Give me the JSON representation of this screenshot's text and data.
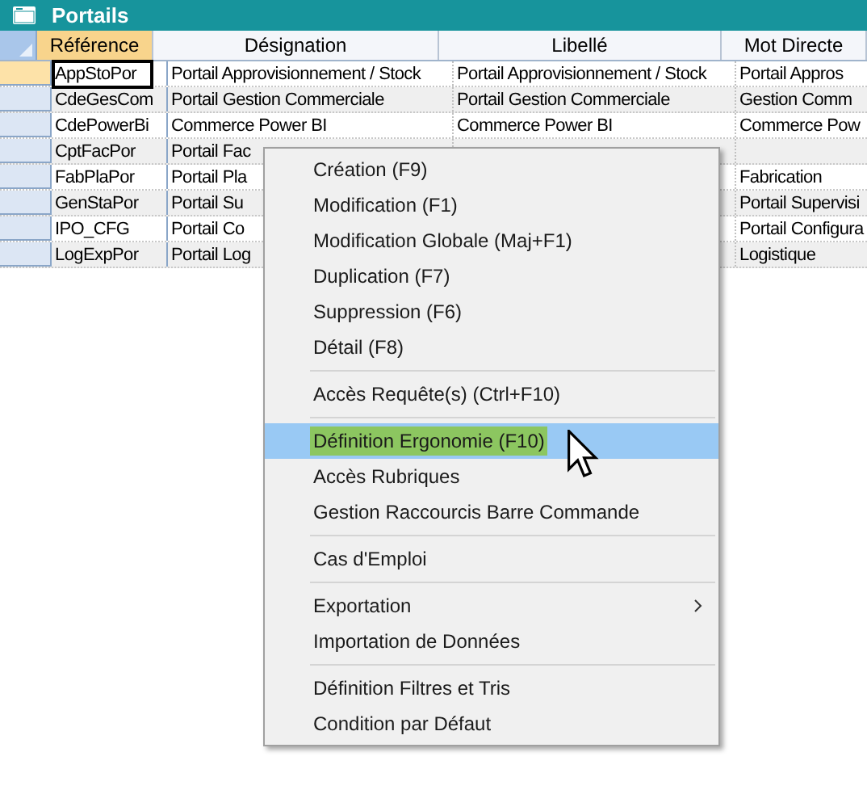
{
  "window": {
    "title": "Portails"
  },
  "table": {
    "columns": [
      {
        "label": "Référence",
        "sorted": true
      },
      {
        "label": "Désignation",
        "sorted": false
      },
      {
        "label": "Libellé",
        "sorted": false
      },
      {
        "label": "Mot Directe",
        "sorted": false
      }
    ],
    "rows": [
      {
        "selected": true,
        "cells": [
          "AppStoPor",
          "Portail Approvisionnement / Stock",
          "Portail Approvisionnement / Stock",
          "Portail Appros"
        ]
      },
      {
        "selected": false,
        "cells": [
          "CdeGesCom",
          "Portail Gestion Commerciale",
          "Portail Gestion Commerciale",
          "Gestion Comm"
        ]
      },
      {
        "selected": false,
        "cells": [
          "CdePowerBi",
          "Commerce Power BI",
          "Commerce Power BI",
          "Commerce Pow"
        ]
      },
      {
        "selected": false,
        "cells": [
          "CptFacPor",
          "Portail Fac",
          null,
          null
        ]
      },
      {
        "selected": false,
        "cells": [
          "FabPlaPor",
          "Portail Pla",
          null,
          "Fabrication"
        ]
      },
      {
        "selected": false,
        "cells": [
          "GenStaPor",
          "Portail Su",
          null,
          "Portail Supervisi"
        ]
      },
      {
        "selected": false,
        "cells": [
          "IPO_CFG",
          "Portail Co",
          null,
          "Portail Configura"
        ]
      },
      {
        "selected": false,
        "cells": [
          "LogExpPor",
          "Portail Log",
          null,
          "Logistique"
        ]
      }
    ]
  },
  "context_menu": {
    "items": [
      {
        "kind": "item",
        "label": "Création (F9)",
        "selected": false
      },
      {
        "kind": "item",
        "label": "Modification (F1)",
        "selected": false
      },
      {
        "kind": "item",
        "label": "Modification Globale (Maj+F1)",
        "selected": false
      },
      {
        "kind": "item",
        "label": "Duplication (F7)",
        "selected": false
      },
      {
        "kind": "item",
        "label": "Suppression (F6)",
        "selected": false
      },
      {
        "kind": "item",
        "label": "Détail (F8)",
        "selected": false
      },
      {
        "kind": "separator"
      },
      {
        "kind": "item",
        "label": "Accès Requête(s) (Ctrl+F10)",
        "selected": false
      },
      {
        "kind": "separator"
      },
      {
        "kind": "item",
        "label": "Définition Ergonomie (F10)",
        "selected": true
      },
      {
        "kind": "item",
        "label": "Accès Rubriques",
        "selected": false
      },
      {
        "kind": "item",
        "label": "Gestion Raccourcis Barre Commande",
        "selected": false
      },
      {
        "kind": "separator"
      },
      {
        "kind": "item",
        "label": "Cas d'Emploi",
        "selected": false
      },
      {
        "kind": "separator"
      },
      {
        "kind": "submenu",
        "label": "Exportation",
        "selected": false
      },
      {
        "kind": "item",
        "label": "Importation de Données",
        "selected": false
      },
      {
        "kind": "separator"
      },
      {
        "kind": "item",
        "label": "Définition Filtres et Tris",
        "selected": false
      },
      {
        "kind": "item",
        "label": "Condition par Défaut",
        "selected": false
      }
    ]
  }
}
